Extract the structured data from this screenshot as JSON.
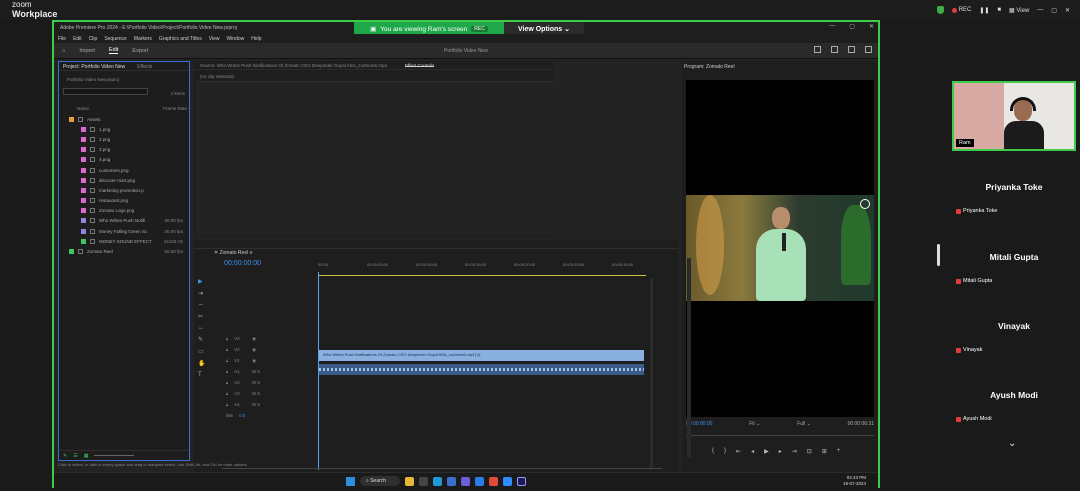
{
  "zoom": {
    "logo_line1": "zoom",
    "logo_line2": "Workplace",
    "rec_label": "REC",
    "view_label": "View"
  },
  "share": {
    "viewing_text": "You are viewing  Ram's screen",
    "rec_label": "REC",
    "view_options": "View Options"
  },
  "premiere": {
    "title": "Adobe Premiere Pro 2024 - E:\\Portfolio Video\\Project\\Portfolio Video New.prproj",
    "menu": [
      "File",
      "Edit",
      "Clip",
      "Sequence",
      "Markers",
      "Graphics and Titles",
      "View",
      "Window",
      "Help"
    ],
    "header_tabs": [
      "Import",
      "Edit",
      "Export"
    ],
    "active_tab": "Edit",
    "center_title": "Portfolio Video New",
    "project_tab": "Project: Portfolio Video New",
    "effects_tab": "Effects",
    "project_path": "Portfolio Video New.prproj",
    "item_count": "2 items",
    "col_name": "Name",
    "col_rate": "Frame Rate",
    "project_items": [
      {
        "name": "Assets",
        "rate": "",
        "color": "#e89a3c",
        "indent": 0
      },
      {
        "name": "1.png",
        "rate": "",
        "color": "#d86ad0",
        "indent": 1
      },
      {
        "name": "2.png",
        "rate": "",
        "color": "#d86ad0",
        "indent": 1
      },
      {
        "name": "3.png",
        "rate": "",
        "color": "#d86ad0",
        "indent": 1
      },
      {
        "name": "4.png",
        "rate": "",
        "color": "#d86ad0",
        "indent": 1
      },
      {
        "name": "customers.png",
        "rate": "",
        "color": "#d86ad0",
        "indent": 1
      },
      {
        "name": "discover-mart.png",
        "rate": "",
        "color": "#d86ad0",
        "indent": 1
      },
      {
        "name": "marketing promotion.p",
        "rate": "",
        "color": "#d86ad0",
        "indent": 1
      },
      {
        "name": "restaurant.png",
        "rate": "",
        "color": "#d86ad0",
        "indent": 1
      },
      {
        "name": "Zomato Logo.png",
        "rate": "",
        "color": "#d86ad0",
        "indent": 1
      },
      {
        "name": "Who Writes Push Notifi",
        "rate": "30.00 fps",
        "color": "#8c86e0",
        "indent": 1
      },
      {
        "name": "Money Falling Green Sc",
        "rate": "30.00 fps",
        "color": "#8c86e0",
        "indent": 1
      },
      {
        "name": "MONEY SOUND EFFECT",
        "rate": "44100 Hz",
        "color": "#3fc55a",
        "indent": 1
      },
      {
        "name": "Zomato Reel",
        "rate": "60.00 fps",
        "color": "#3fc55a",
        "indent": 0
      }
    ],
    "source_label": "Source: Who Writes Push Notifications Of Zomato CEO Deepinder Goyal ASA_zoZeem6.mp4",
    "effect_controls": "Effect Controls",
    "no_clip": "(no clip selected)",
    "program_label": "Program: Zomato Reel",
    "program_tc": "00:00:00:00",
    "fit_label": "Fit",
    "full_label": "Full",
    "duration_tc": "00:00:06:31",
    "sequence_tab": "Zomato Reel",
    "timeline_tc": "00:00:00:00",
    "ruler": [
      "00:00",
      "00:00:05:00",
      "00:00:10:00",
      "00:00:15:00",
      "00:00:20:00",
      "00:00:25:00",
      "00:00:30:00"
    ],
    "video_tracks": [
      "V3",
      "V2",
      "V1"
    ],
    "audio_tracks": [
      "A1",
      "A2",
      "A3",
      "A4"
    ],
    "mix_label": "Mix",
    "mix_value": "0.0",
    "video_clip": "Who Writes Push Notifications Of Zomato CEO Deepinder Goyal ASA_zoZeem6.mp4 [V]",
    "status_text": "Click to select, or click in empty space and drag to marquee select. Use Shift, Alt, and Ctrl for other options."
  },
  "taskbar": {
    "search": "Search",
    "time": "02:43 PM",
    "date": "19-07-2024"
  },
  "participants": {
    "self_name": "Ram",
    "list": [
      "Priyanka Toke",
      "Mitali Gupta",
      "Vinayak",
      "Ayush Modi"
    ]
  }
}
